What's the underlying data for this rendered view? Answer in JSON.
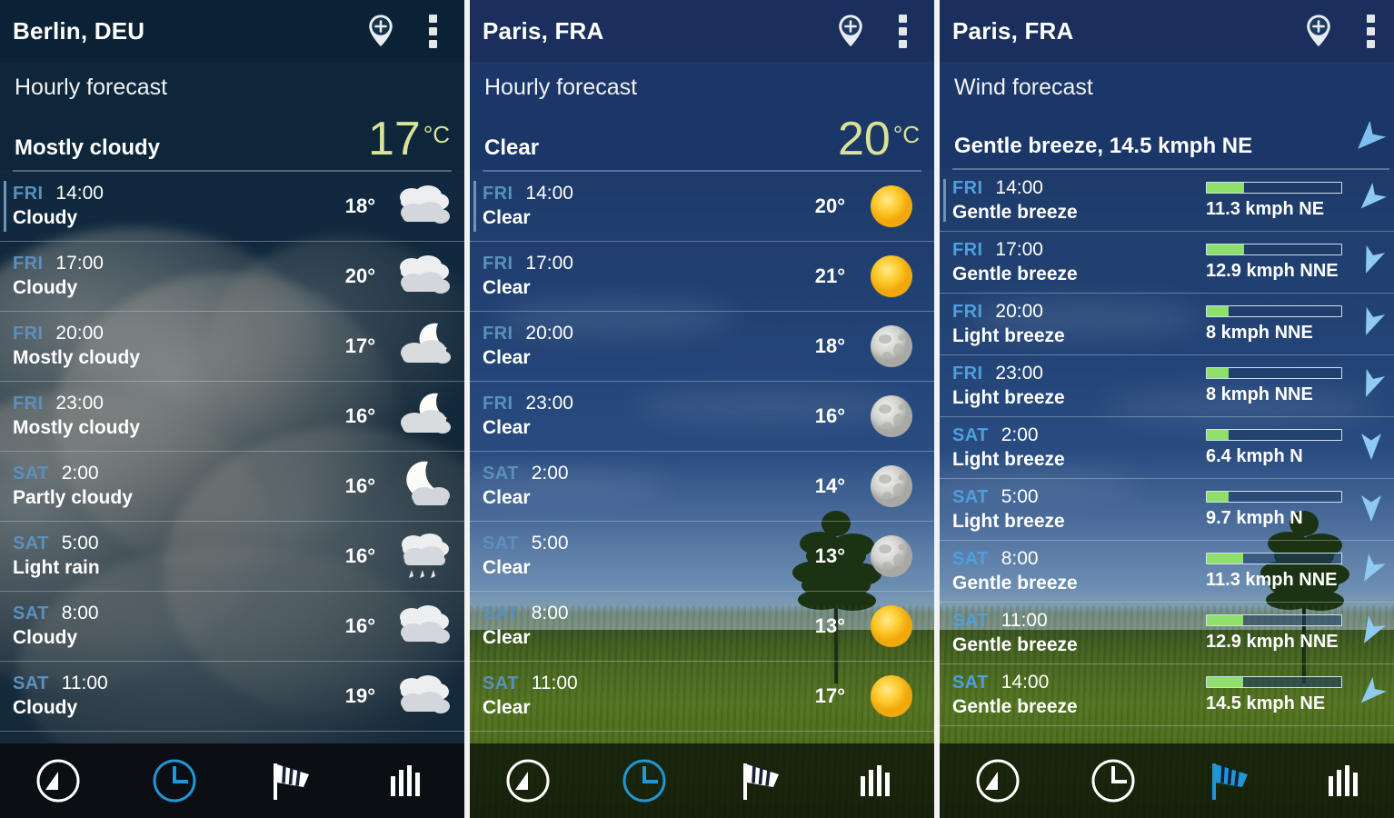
{
  "app": {
    "accent_active": "#2196d4",
    "accent_inactive": "#ffffff",
    "temp_color": "#d9e296",
    "wind_bar_color": "#8ee06a",
    "day_label_color": "#5b90bd"
  },
  "panels": [
    {
      "id": "berlin-hourly",
      "city": "Berlin, DEU",
      "screen_title": "Hourly forecast",
      "condition": "Mostly cloudy",
      "temperature": "17",
      "temperature_unit": "°C",
      "type": "hourly",
      "rows": [
        {
          "day": "FRI",
          "time": "14:00",
          "desc": "Cloudy",
          "temp": "18°",
          "icon": "cloudy-icon"
        },
        {
          "day": "FRI",
          "time": "17:00",
          "desc": "Cloudy",
          "temp": "20°",
          "icon": "cloudy-icon"
        },
        {
          "day": "FRI",
          "time": "20:00",
          "desc": "Mostly cloudy",
          "temp": "17°",
          "icon": "moon-cloudy-icon"
        },
        {
          "day": "FRI",
          "time": "23:00",
          "desc": "Mostly cloudy",
          "temp": "16°",
          "icon": "moon-cloudy-icon"
        },
        {
          "day": "SAT",
          "time": "2:00",
          "desc": "Partly cloudy",
          "temp": "16°",
          "icon": "moon-partly-cloudy-icon"
        },
        {
          "day": "SAT",
          "time": "5:00",
          "desc": "Light rain",
          "temp": "16°",
          "icon": "rain-icon"
        },
        {
          "day": "SAT",
          "time": "8:00",
          "desc": "Cloudy",
          "temp": "16°",
          "icon": "cloudy-icon"
        },
        {
          "day": "SAT",
          "time": "11:00",
          "desc": "Cloudy",
          "temp": "19°",
          "icon": "cloudy-icon"
        }
      ],
      "nav_active": "clock"
    },
    {
      "id": "paris-hourly",
      "city": "Paris, FRA",
      "screen_title": "Hourly forecast",
      "condition": "Clear",
      "temperature": "20",
      "temperature_unit": "°C",
      "type": "hourly",
      "rows": [
        {
          "day": "FRI",
          "time": "14:00",
          "desc": "Clear",
          "temp": "20°",
          "icon": "sun-icon"
        },
        {
          "day": "FRI",
          "time": "17:00",
          "desc": "Clear",
          "temp": "21°",
          "icon": "sun-icon"
        },
        {
          "day": "FRI",
          "time": "20:00",
          "desc": "Clear",
          "temp": "18°",
          "icon": "moon-icon"
        },
        {
          "day": "FRI",
          "time": "23:00",
          "desc": "Clear",
          "temp": "16°",
          "icon": "moon-icon"
        },
        {
          "day": "SAT",
          "time": "2:00",
          "desc": "Clear",
          "temp": "14°",
          "icon": "moon-icon"
        },
        {
          "day": "SAT",
          "time": "5:00",
          "desc": "Clear",
          "temp": "13°",
          "icon": "moon-icon"
        },
        {
          "day": "SAT",
          "time": "8:00",
          "desc": "Clear",
          "temp": "13°",
          "icon": "sun-icon"
        },
        {
          "day": "SAT",
          "time": "11:00",
          "desc": "Clear",
          "temp": "17°",
          "icon": "sun-icon"
        }
      ],
      "nav_active": "clock"
    },
    {
      "id": "paris-wind",
      "city": "Paris, FRA",
      "screen_title": "Wind forecast",
      "condition": "Gentle breeze, 14.5 kmph NE",
      "type": "wind",
      "rows": [
        {
          "day": "FRI",
          "time": "14:00",
          "desc": "Gentle breeze",
          "speed": "11.3 kmph NE",
          "bar_percent": 28,
          "direction_deg": 225
        },
        {
          "day": "FRI",
          "time": "17:00",
          "desc": "Gentle breeze",
          "speed": "12.9 kmph NNE",
          "bar_percent": 28,
          "direction_deg": 202
        },
        {
          "day": "FRI",
          "time": "20:00",
          "desc": "Light breeze",
          "speed": "8 kmph NNE",
          "bar_percent": 16,
          "direction_deg": 202
        },
        {
          "day": "FRI",
          "time": "23:00",
          "desc": "Light breeze",
          "speed": "8 kmph NNE",
          "bar_percent": 16,
          "direction_deg": 202
        },
        {
          "day": "SAT",
          "time": "2:00",
          "desc": "Light breeze",
          "speed": "6.4 kmph N",
          "bar_percent": 16,
          "direction_deg": 180
        },
        {
          "day": "SAT",
          "time": "5:00",
          "desc": "Light breeze",
          "speed": "9.7 kmph N",
          "bar_percent": 16,
          "direction_deg": 180
        },
        {
          "day": "SAT",
          "time": "8:00",
          "desc": "Gentle breeze",
          "speed": "11.3 kmph NNE",
          "bar_percent": 27,
          "direction_deg": 210
        },
        {
          "day": "SAT",
          "time": "11:00",
          "desc": "Gentle breeze",
          "speed": "12.9 kmph NNE",
          "bar_percent": 27,
          "direction_deg": 210
        },
        {
          "day": "SAT",
          "time": "14:00",
          "desc": "Gentle breeze",
          "speed": "14.5 kmph NE",
          "bar_percent": 27,
          "direction_deg": 225
        }
      ],
      "nav_active": "wind"
    }
  ],
  "titlebar_icons": {
    "add_location": "add-location-pin-icon",
    "overflow": "overflow-menu-icon"
  },
  "navbar": {
    "items": [
      {
        "key": "compass",
        "icon": "compass-icon"
      },
      {
        "key": "clock",
        "icon": "clock-icon"
      },
      {
        "key": "wind",
        "icon": "windsock-icon"
      },
      {
        "key": "chart",
        "icon": "bar-chart-icon"
      }
    ]
  }
}
